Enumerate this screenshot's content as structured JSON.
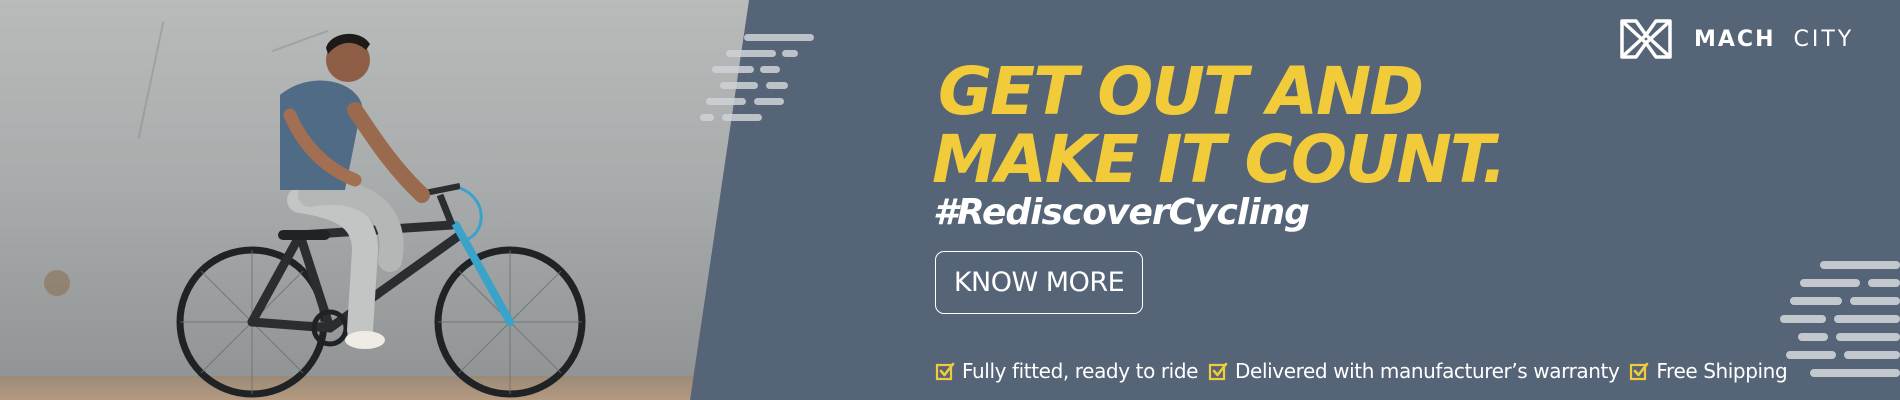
{
  "brand": {
    "logo_icon": "mach-city-logo-icon",
    "name_part1": "MACH",
    "name_part2": "CITY"
  },
  "headline": {
    "line1": "GET OUT AND",
    "line2": "MAKE IT COUNT.",
    "hashtag": "#RediscoverCycling"
  },
  "cta": {
    "label": "KNOW MORE"
  },
  "features": [
    {
      "icon": "checkbox-icon",
      "label": "Fully fitted, ready to ride"
    },
    {
      "icon": "checkbox-icon",
      "label": "Delivered with manufacturer’s warranty"
    },
    {
      "icon": "checkbox-icon",
      "label": "Free Shipping"
    }
  ],
  "colors": {
    "background": "#566477",
    "accent": "#f2cb3a",
    "text": "#ffffff"
  }
}
